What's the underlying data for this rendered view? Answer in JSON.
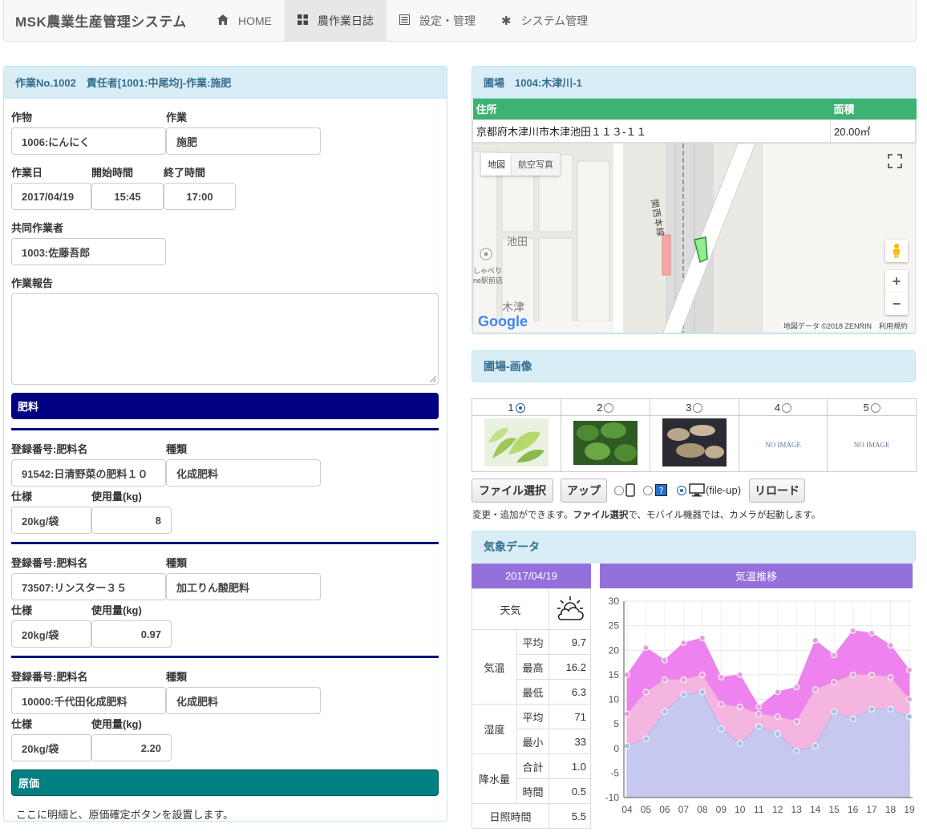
{
  "navbar": {
    "brand": "MSK農業生産管理システム",
    "items": [
      {
        "label": "HOME",
        "icon": "home-icon"
      },
      {
        "label": "農作業日誌",
        "icon": "dashboard-icon"
      },
      {
        "label": "設定・管理",
        "icon": "list-icon"
      },
      {
        "label": "システム管理",
        "icon": "asterisk-icon"
      }
    ]
  },
  "work": {
    "heading": "作業No.1002　責任者[1001:中尾均]-作業:施肥",
    "crop_label": "作物",
    "crop_value": "1006:にんにく",
    "task_label": "作業",
    "task_value": "施肥",
    "date_label": "作業日",
    "date_value": "2017/04/19",
    "start_label": "開始時間",
    "start_value": "15:45",
    "end_label": "終了時間",
    "end_value": "17:00",
    "coworker_label": "共同作業者",
    "coworker_value": "1003:佐藤吾郎",
    "report_label": "作業報告",
    "report_value": ""
  },
  "fertilizer": {
    "heading": "肥料",
    "reg_label": "登録番号:肥料名",
    "type_label": "種類",
    "spec_label": "仕様",
    "amount_label": "使用量(kg)",
    "items": [
      {
        "name": "91542:日清野菜の肥料１０",
        "type": "化成肥料",
        "spec": "20kg/袋",
        "amount": "8"
      },
      {
        "name": "73507:リンスター３５",
        "type": "加工りん酸肥料",
        "spec": "20kg/袋",
        "amount": "0.97"
      },
      {
        "name": "10000:千代田化成肥料",
        "type": "化成肥料",
        "spec": "20kg/袋",
        "amount": "2.20"
      }
    ]
  },
  "cost": {
    "heading": "原価",
    "note": "ここに明細と、原価確定ボタンを設置します。"
  },
  "field": {
    "heading": "圃場　1004:木津川-1",
    "address_header": "住所",
    "area_header": "面積",
    "address": "京都府木津川市木津池田１１３-１１",
    "area": "20.00㎡"
  },
  "map": {
    "tab_map": "地図",
    "tab_aerial": "航空写真",
    "label_ikeda": "池田",
    "label_kizu": "木津",
    "label_line": "関西本線",
    "label_shop1": "しゃべり",
    "label_shop2": "ne駅前店",
    "logo": "Google",
    "attribution": "地図データ ©2018 ZENRIN　利用規約",
    "zoom_in": "+",
    "zoom_out": "−"
  },
  "images": {
    "heading": "圃場-画像",
    "slots": [
      "1",
      "2",
      "3",
      "4",
      "5"
    ],
    "no_image": "NO IMAGE",
    "btn_select": "ファイル選択",
    "btn_upload": "アップ",
    "fileup_label": "(file-up)",
    "btn_reload": "リロード",
    "help_pre": "変更・追加ができます。",
    "help_bold": "ファイル選択",
    "help_post": "で、モバイル機器では、カメラが起動します。"
  },
  "weather": {
    "heading": "気象データ",
    "date": "2017/04/19",
    "chart_title": "気温推移",
    "weather_label": "天気",
    "temp_label": "気温",
    "humidity_label": "湿度",
    "rain_label": "降水量",
    "sunshine_label": "日照時間",
    "avg_label": "平均",
    "max_label": "最高",
    "min_label": "最低",
    "hum_avg_label": "平均",
    "hum_min_label": "最小",
    "rain_total_label": "合計",
    "rain_hour_label": "時間",
    "temp_avg": "9.7",
    "temp_max": "16.2",
    "temp_min": "6.3",
    "hum_avg": "71",
    "hum_min": "33",
    "rain_total": "1.0",
    "rain_hour": "0.5",
    "sunshine": "5.5"
  },
  "chart_data": {
    "type": "area",
    "title": "気温推移",
    "categories": [
      "04",
      "05",
      "06",
      "07",
      "08",
      "09",
      "10",
      "11",
      "12",
      "13",
      "14",
      "15",
      "16",
      "17",
      "18",
      "19"
    ],
    "series": [
      {
        "values": [
          15,
          20.5,
          18,
          21.5,
          22.5,
          14.5,
          15,
          8.5,
          11.5,
          12.5,
          22,
          19,
          24,
          23.5,
          21,
          16
        ]
      },
      {
        "values": [
          7,
          11.5,
          14,
          14,
          15,
          9,
          8.5,
          7,
          6.5,
          5.5,
          12,
          13.5,
          15,
          15,
          14.5,
          10
        ]
      },
      {
        "values": [
          0.5,
          2,
          7.5,
          11,
          11.5,
          4,
          1,
          4.5,
          3,
          -0.5,
          0.5,
          7.5,
          6,
          8,
          8,
          6.5
        ]
      }
    ],
    "colors": [
      "#ee82ee",
      "#f4b6e0",
      "#c6c8f0"
    ],
    "ylim": [
      -10,
      30
    ],
    "yticks": [
      30,
      25,
      20,
      15,
      10,
      5,
      0,
      -5,
      -10
    ],
    "grid": true
  }
}
